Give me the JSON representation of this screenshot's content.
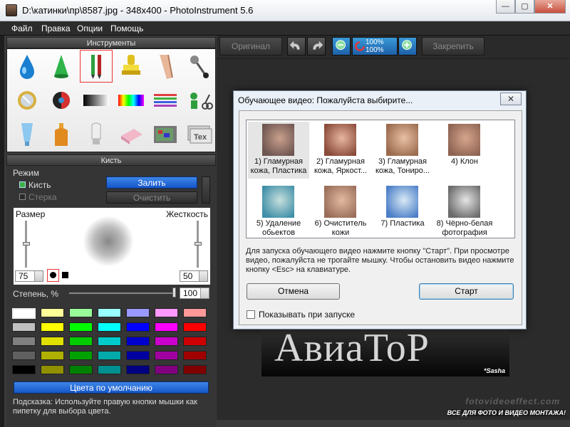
{
  "window": {
    "title": "D:\\катинки\\пр\\8587.jpg - 348x400 - PhotoInstrument 5.6",
    "minimize": "—",
    "maximize": "▢",
    "close": "✕"
  },
  "menu": [
    "Файл",
    "Правка",
    "Опции",
    "Помощь"
  ],
  "tools": {
    "header": "Инструменты",
    "items": [
      "water-drop-icon",
      "cone-icon",
      "brush-pencil-icon",
      "stamp-icon",
      "eraser-finger-icon",
      "pin-icon",
      "lens-icon",
      "eye-icon",
      "gradient-icon",
      "spectrum-icon",
      "lines-icon",
      "clone-scissors-icon",
      "tube-icon",
      "bottle-icon",
      "lamp-icon",
      "soap-icon",
      "tv-icon",
      "text-icon"
    ],
    "selected_index": 2
  },
  "brush": {
    "header": "Кисть",
    "mode_label": "Режим",
    "brush_option": "Кисть",
    "eraser_option": "Стерка",
    "fill_button": "Залить",
    "clear_button": "Очистить",
    "size_label": "Размер",
    "hardness_label": "Жесткость",
    "size_value": "75",
    "hardness_value": "50",
    "degree_label": "Степень, %",
    "degree_value": "100"
  },
  "palette": {
    "colors": [
      [
        "#ffffff",
        "#ffff99",
        "#99ff99",
        "#99ffff",
        "#9999ff",
        "#ff99ff",
        "#ff9999"
      ],
      [
        "#c0c0c0",
        "#ffff00",
        "#00ff00",
        "#00ffff",
        "#0000ff",
        "#ff00ff",
        "#ff0000"
      ],
      [
        "#808080",
        "#e0e000",
        "#00cc00",
        "#00cccc",
        "#0000cc",
        "#cc00cc",
        "#cc0000"
      ],
      [
        "#606060",
        "#b0b000",
        "#00a000",
        "#00aaaa",
        "#0000a0",
        "#a000a0",
        "#a00000"
      ],
      [
        "#000000",
        "#909000",
        "#008000",
        "#009090",
        "#000080",
        "#800080",
        "#800000"
      ]
    ],
    "default_button": "Цвета по умолчанию",
    "hint": "Подсказка: Используйте правую кнопки мышки как пипетку для выбора цвета."
  },
  "toolbar": {
    "original": "Оригинал",
    "pin": "Закрепить",
    "zoom_a": "100%",
    "zoom_b": "100%"
  },
  "canvas": {
    "photo_text": "АвиаТоР",
    "signature": "*Sasha",
    "watermark_site": "fotovideoeffect.com",
    "watermark_tag": "ВСЕ ДЛЯ ФОТО И ВИДЕО МОНТАЖА!"
  },
  "dialog": {
    "title": "Обучающее видео: Пожалуйста выбирите...",
    "close": "✕",
    "lessons": [
      {
        "label": "1) Гламурная кожа, Пластика",
        "thumb": [
          "#6d5550",
          "#c9a08c"
        ]
      },
      {
        "label": "2) Гламурная кожа, Яркост...",
        "thumb": [
          "#8a4b3a",
          "#e8b6a0"
        ]
      },
      {
        "label": "3) Гламурная кожа, Тониро...",
        "thumb": [
          "#9b6a4e",
          "#e9c0a4"
        ]
      },
      {
        "label": "4) Клон",
        "thumb": [
          "#8e6453",
          "#d7a58d"
        ]
      },
      {
        "label": "5) Удаление обьектов",
        "thumb": [
          "#3f8fa8",
          "#c7e0dd"
        ]
      },
      {
        "label": "6) Очиститель кожи",
        "thumb": [
          "#9a6e5a",
          "#e3b9a0"
        ]
      },
      {
        "label": "7) Пластика",
        "thumb": [
          "#4b7fc7",
          "#d9e9f5"
        ]
      },
      {
        "label": "8) Чёрно-белая фотография",
        "thumb": [
          "#6a6a6a",
          "#e4e4e4"
        ]
      }
    ],
    "info": "Для запуска обучающего видео нажмите кнопку \"Старт\". При просмотре видео, пожалуйста не трогайте мышку. Чтобы остановить видео нажмите кнопку <Esc> на клавиатуре.",
    "cancel_button": "Отмена",
    "start_button": "Старт",
    "show_on_start": "Показывать при запуске"
  }
}
